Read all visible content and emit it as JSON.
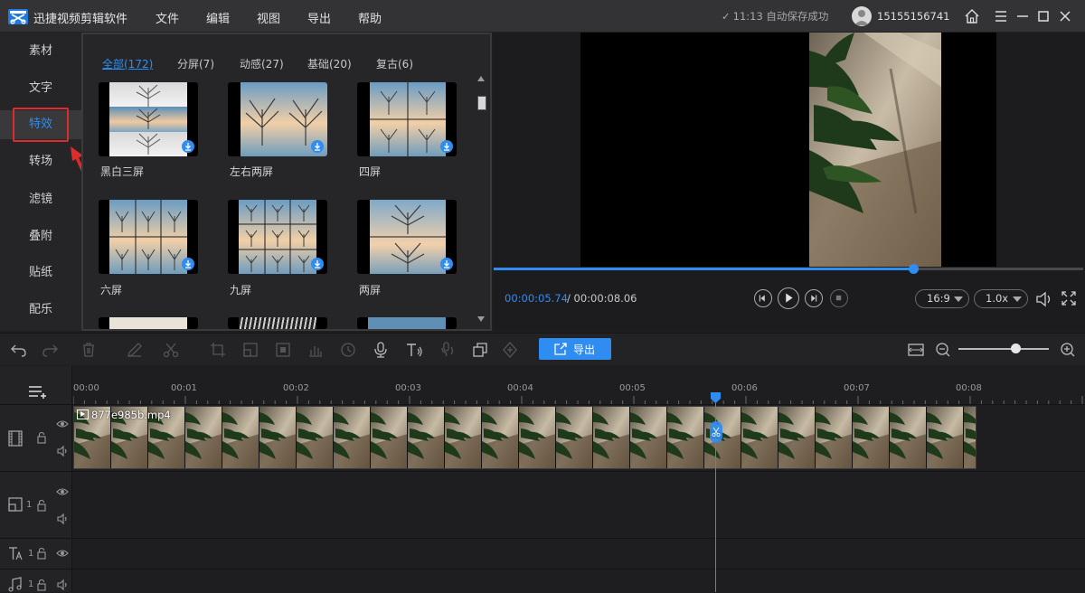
{
  "app": {
    "title": "迅捷视频剪辑软件",
    "menu": [
      "文件",
      "编辑",
      "视图",
      "导出",
      "帮助"
    ],
    "save_status": "11:13 自动保存成功",
    "username": "15155156741"
  },
  "sidenav": {
    "items": [
      "素材",
      "文字",
      "特效",
      "转场",
      "滤镜",
      "叠附",
      "贴纸",
      "配乐"
    ],
    "active": "特效"
  },
  "effects": {
    "categories": [
      "全部(172)",
      "分屏(7)",
      "动感(27)",
      "基础(20)",
      "复古(6)"
    ],
    "active_category": "全部(172)",
    "items": [
      {
        "label": "黑白三屏"
      },
      {
        "label": "左右两屏"
      },
      {
        "label": "四屏"
      },
      {
        "label": "六屏"
      },
      {
        "label": "九屏"
      },
      {
        "label": "两屏"
      }
    ]
  },
  "preview": {
    "time_current": "00:00:05.74",
    "time_total": "/ 00:00:08.06",
    "progress_fraction": 0.712,
    "aspect_ratio": "16:9",
    "speed": "1.0x"
  },
  "toolbar": {
    "export_label": "导出",
    "zoom_fraction": 0.63
  },
  "timeline": {
    "ruler": [
      "00:00",
      "00:01",
      "00:02",
      "00:03",
      "00:04",
      "00:05",
      "00:06",
      "00:07",
      "00:08"
    ],
    "clip_name": "877e985b.mp4",
    "track_numbers": [
      "1",
      "1",
      "1"
    ]
  },
  "colors": {
    "accent": "#2f8cf0",
    "highlight_red": "#e02b2b"
  }
}
